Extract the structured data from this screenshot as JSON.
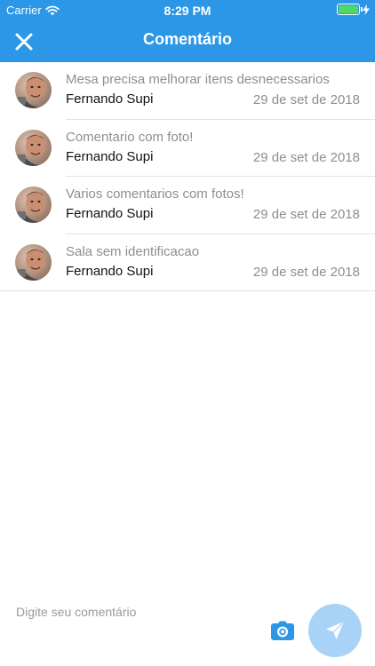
{
  "status_bar": {
    "carrier": "Carrier",
    "time": "8:29 PM",
    "battery_level": 1.0,
    "icons": [
      "wifi-icon",
      "battery-icon",
      "charging-bolt-icon"
    ]
  },
  "nav": {
    "title": "Comentário",
    "close_icon": "close-icon",
    "background_color": "#2b97e6"
  },
  "comments": [
    {
      "text": "Mesa precisa melhorar itens desnecessarios",
      "author": "Fernando Supi",
      "date": "29 de set de 2018"
    },
    {
      "text": "Comentario com foto!",
      "author": "Fernando Supi",
      "date": "29 de set de 2018"
    },
    {
      "text": "Varios comentarios com fotos!",
      "author": "Fernando Supi",
      "date": "29 de set de 2018"
    },
    {
      "text": "Sala sem identificacao",
      "author": "Fernando Supi",
      "date": "29 de set de 2018"
    }
  ],
  "composer": {
    "placeholder": "Digite seu comentário",
    "value": "",
    "camera_icon": "camera-icon",
    "send_icon": "send-icon",
    "send_button_color": "#a8d2f6"
  }
}
